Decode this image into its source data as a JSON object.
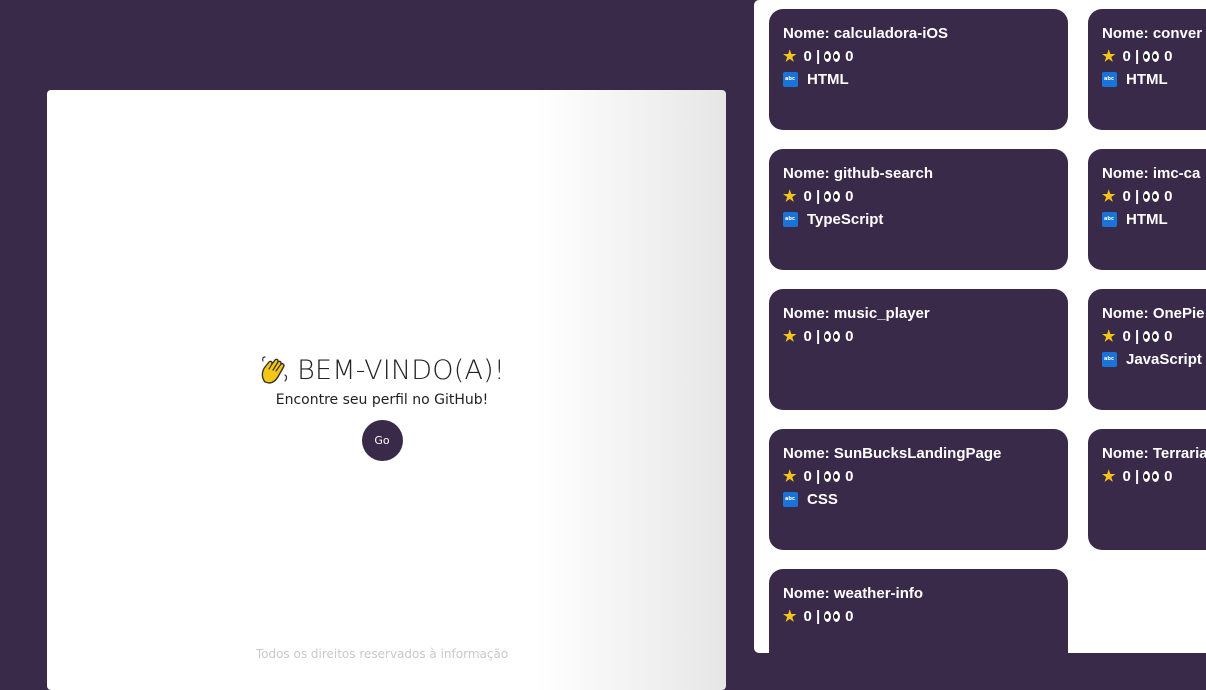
{
  "welcome": {
    "title": "BEM-VINDO(A)!",
    "subtitle": "Encontre seu perfil no GitHub!",
    "go_label": "Go",
    "footer_text": "Todos os direitos reservados à informação"
  },
  "colors": {
    "background": "#3a2a4a",
    "card": "#3a2a4a",
    "star": "#f5c518",
    "language_icon": "#1a73d9"
  },
  "icons": {
    "wave": "waving-hand-icon",
    "star": "star-icon",
    "watchers": "eyes-icon",
    "language": "abc-icon"
  },
  "repos": [
    {
      "name": "Nome: calculadora-iOS",
      "stars": "0",
      "watchers": "0",
      "language": "HTML"
    },
    {
      "name": "Nome: conver",
      "stars": "0",
      "watchers": "0",
      "language": "HTML"
    },
    {
      "name": "Nome: github-search",
      "stars": "0",
      "watchers": "0",
      "language": "TypeScript"
    },
    {
      "name": "Nome: imc-ca",
      "stars": "0",
      "watchers": "0",
      "language": "HTML"
    },
    {
      "name": "Nome: music_player",
      "stars": "0",
      "watchers": "0",
      "language": ""
    },
    {
      "name": "Nome: OnePie",
      "stars": "0",
      "watchers": "0",
      "language": "JavaScript"
    },
    {
      "name": "Nome: SunBucksLandingPage",
      "stars": "0",
      "watchers": "0",
      "language": "CSS"
    },
    {
      "name": "Nome: Terraria",
      "stars": "0",
      "watchers": "0",
      "language": ""
    },
    {
      "name": "Nome: weather-info",
      "stars": "0",
      "watchers": "0",
      "language": ""
    }
  ]
}
